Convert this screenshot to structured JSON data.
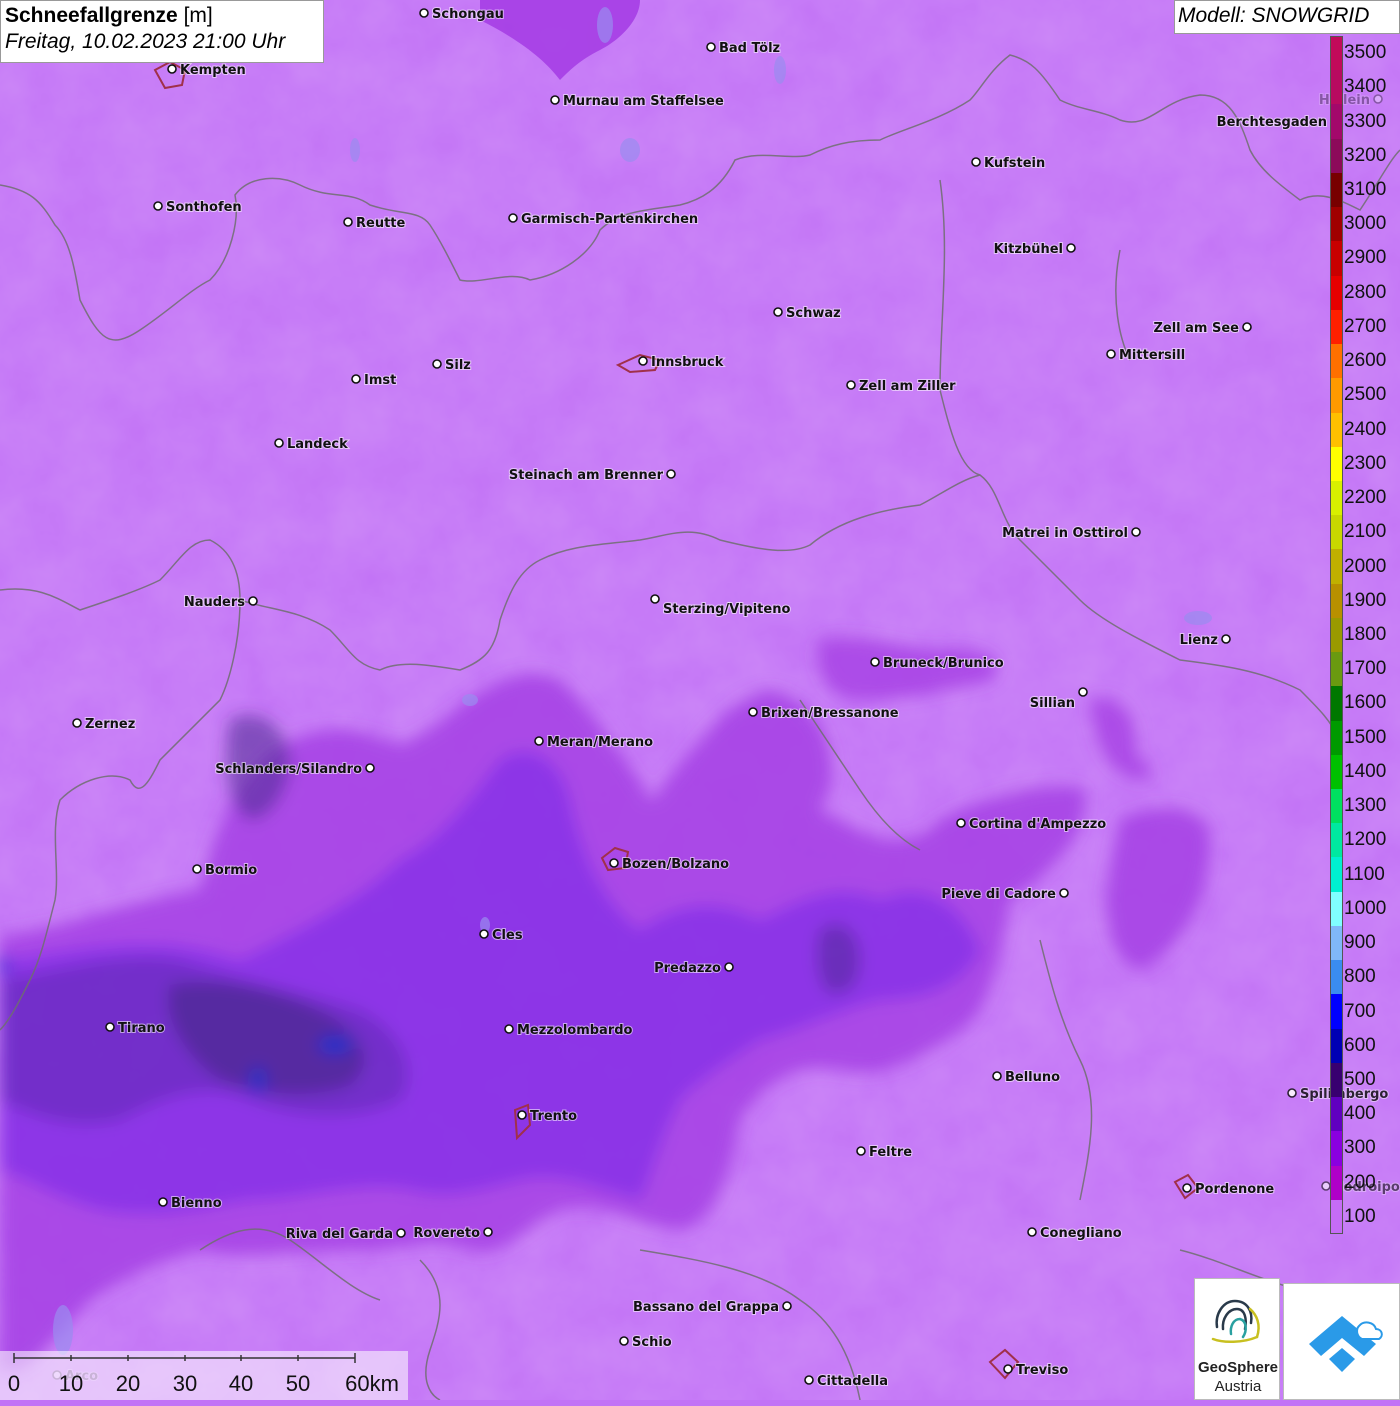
{
  "header": {
    "title": "Schneefallgrenze",
    "unit": "[m]",
    "datetime": "Freitag, 10.02.2023 21:00 Uhr"
  },
  "model": {
    "label": "Modell: SNOWGRID"
  },
  "legend": {
    "entries": [
      {
        "value": "3500",
        "color": "#c20a5a"
      },
      {
        "value": "3400",
        "color": "#b80a60"
      },
      {
        "value": "3300",
        "color": "#a3086b"
      },
      {
        "value": "3200",
        "color": "#8c0a5a"
      },
      {
        "value": "3100",
        "color": "#780000"
      },
      {
        "value": "3000",
        "color": "#a00000"
      },
      {
        "value": "2900",
        "color": "#c80000"
      },
      {
        "value": "2800",
        "color": "#e60000"
      },
      {
        "value": "2700",
        "color": "#ff2000"
      },
      {
        "value": "2600",
        "color": "#ff7000"
      },
      {
        "value": "2500",
        "color": "#ff9a00"
      },
      {
        "value": "2400",
        "color": "#ffc000"
      },
      {
        "value": "2300",
        "color": "#ffff00"
      },
      {
        "value": "2200",
        "color": "#d8f000"
      },
      {
        "value": "2100",
        "color": "#c8d800"
      },
      {
        "value": "2000",
        "color": "#c0b000"
      },
      {
        "value": "1900",
        "color": "#b89000"
      },
      {
        "value": "1800",
        "color": "#9a9a00"
      },
      {
        "value": "1700",
        "color": "#6a9a10"
      },
      {
        "value": "1600",
        "color": "#007800"
      },
      {
        "value": "1500",
        "color": "#009a00"
      },
      {
        "value": "1400",
        "color": "#00c000"
      },
      {
        "value": "1300",
        "color": "#00e060"
      },
      {
        "value": "1200",
        "color": "#00e8a0"
      },
      {
        "value": "1100",
        "color": "#00f0d0"
      },
      {
        "value": "1000",
        "color": "#80ffff"
      },
      {
        "value": "900",
        "color": "#80b8f8"
      },
      {
        "value": "800",
        "color": "#3a8cf0"
      },
      {
        "value": "700",
        "color": "#0000ff"
      },
      {
        "value": "600",
        "color": "#0000b4"
      },
      {
        "value": "500",
        "color": "#380070"
      },
      {
        "value": "400",
        "color": "#6000c0"
      },
      {
        "value": "300",
        "color": "#8a00e0"
      },
      {
        "value": "200",
        "color": "#b000c8"
      },
      {
        "value": "100",
        "color": "#c66cf6"
      }
    ]
  },
  "cities": [
    {
      "name": "Schongau"
    },
    {
      "name": "Kempten"
    },
    {
      "name": "Bad Tölz"
    },
    {
      "name": "Murnau am Staffelsee"
    },
    {
      "name": "Berchtesgaden"
    },
    {
      "name": "Kufstein"
    },
    {
      "name": "Sonthofen"
    },
    {
      "name": "Reutte"
    },
    {
      "name": "Garmisch-Partenkirchen"
    },
    {
      "name": "Kitzbühel"
    },
    {
      "name": "Schwaz"
    },
    {
      "name": "Zell am See"
    },
    {
      "name": "Innsbruck"
    },
    {
      "name": "Mittersill"
    },
    {
      "name": "Imst"
    },
    {
      "name": "Silz"
    },
    {
      "name": "Zell am Ziller"
    },
    {
      "name": "Landeck"
    },
    {
      "name": "Steinach am Brenner"
    },
    {
      "name": "Matrei in Osttirol"
    },
    {
      "name": "Nauders"
    },
    {
      "name": "Sterzing/Vipiteno"
    },
    {
      "name": "Lienz"
    },
    {
      "name": "Bruneck/Brunico"
    },
    {
      "name": "Sillian"
    },
    {
      "name": "Brixen/Bressanone"
    },
    {
      "name": "Zernez"
    },
    {
      "name": "Meran/Merano"
    },
    {
      "name": "Schlanders/Silandro"
    },
    {
      "name": "Cortina d'Ampezzo"
    },
    {
      "name": "Bozen/Bolzano"
    },
    {
      "name": "Bormio"
    },
    {
      "name": "Pieve di Cadore"
    },
    {
      "name": "Cles"
    },
    {
      "name": "Predazzo"
    },
    {
      "name": "Tirano"
    },
    {
      "name": "Mezzolombardo"
    },
    {
      "name": "Belluno"
    },
    {
      "name": "Spilimbergo"
    },
    {
      "name": "Trento"
    },
    {
      "name": "Feltre"
    },
    {
      "name": "Pordenone"
    },
    {
      "name": "Codroipo"
    },
    {
      "name": "Bienno"
    },
    {
      "name": "Riva del Garda"
    },
    {
      "name": "Rovereto"
    },
    {
      "name": "Conegliano"
    },
    {
      "name": "Bassano del Grappa"
    },
    {
      "name": "Schio"
    },
    {
      "name": "Treviso"
    },
    {
      "name": "Cittadella"
    },
    {
      "name": "Hallein"
    },
    {
      "name": "Arco"
    }
  ],
  "scalebar": {
    "ticks": [
      "0",
      "10",
      "20",
      "30",
      "40",
      "50",
      "60km"
    ]
  },
  "logos": {
    "geosphere_name": "GeoSphere",
    "geosphere_sub": "Austria"
  }
}
